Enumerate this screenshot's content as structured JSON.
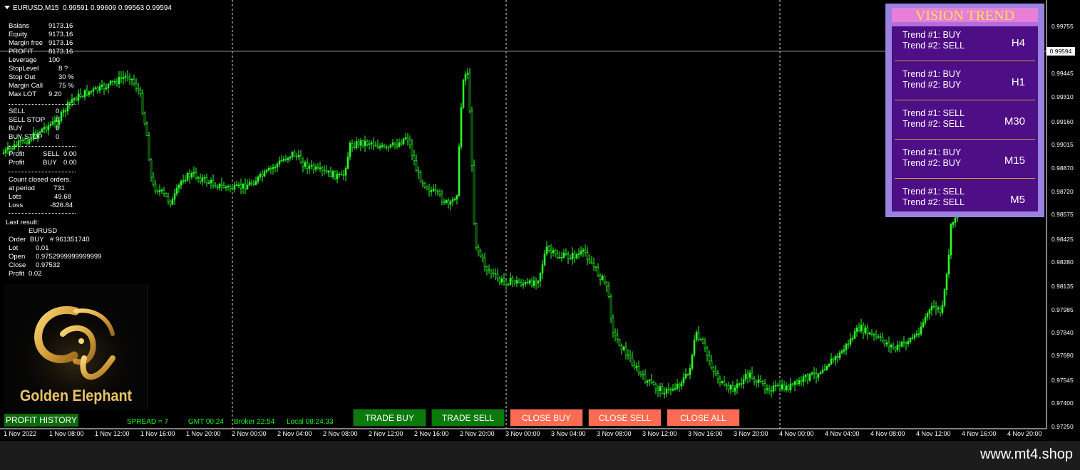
{
  "header": {
    "symbol": "EURUSD,M15",
    "ohlc": "0.99591 0.99609 0.99563 0.99594"
  },
  "account": [
    {
      "label": "Balans",
      "value": "9173.16"
    },
    {
      "label": "Equity",
      "value": "9173.16"
    },
    {
      "label": "Margin free",
      "value": "9173.16"
    },
    {
      "label": "PROFIT",
      "value": "8173.16"
    },
    {
      "label": "Leverage",
      "value": "100"
    },
    {
      "label": "StopLevel",
      "value": "8 ?"
    },
    {
      "label": "Stop Out",
      "value": "30 %"
    },
    {
      "label": "Margin Call",
      "value": "75 %"
    },
    {
      "label": "Max LOT",
      "value": "9.20"
    }
  ],
  "orders": [
    {
      "label": "SELL",
      "value": "0"
    },
    {
      "label": "SELL STOP",
      "value": "0"
    },
    {
      "label": "BUY",
      "value": "0"
    },
    {
      "label": "BUY STOP",
      "value": "0"
    }
  ],
  "profits": [
    {
      "label": "Profit",
      "side": "SELL",
      "value": "0.00"
    },
    {
      "label": "Profit",
      "side": "BUY",
      "value": "0.00"
    }
  ],
  "closed": {
    "title": "Count closed orders.",
    "rows": [
      {
        "label": "at period",
        "value": "731"
      },
      {
        "label": "Lots",
        "value": "49.68"
      },
      {
        "label": "Loss",
        "value": "-826.84"
      }
    ]
  },
  "last_result": {
    "title": "Last result:",
    "symbol": "EURUSD",
    "order_label": "Order",
    "order_side": "BUY",
    "order_no": "# 961351740",
    "lot_label": "Lot",
    "lot": "0.01",
    "open_label": "Open",
    "open": "0.9752999999999999",
    "close_label": "Close",
    "close": "0.97532",
    "profit_label": "Profit",
    "profit": "0.02"
  },
  "logo": {
    "text": "Golden Elephant",
    "icon": "golden-elephant-logo-icon"
  },
  "status_bar": {
    "profit_history": "PROFIT HISTORY",
    "spread": "SPREAD = 7",
    "gmt": "GMT 00:24",
    "broker": "Broker 22:54",
    "local": "Local 08:24:33"
  },
  "buttons": {
    "trade_buy": "TRADE BUY",
    "trade_sell": "TRADE SELL",
    "close_buy": "CLOSE BUY",
    "close_sell": "CLOSE SELL",
    "close_all": "CLOSE ALL"
  },
  "vision_trend": {
    "title": "VISION TREND",
    "rows": [
      {
        "t1": "Trend #1: BUY",
        "t2": "Trend #2: SELL",
        "tf": "H4"
      },
      {
        "t1": "Trend #1: BUY",
        "t2": "Trend #2: BUY",
        "tf": "H1"
      },
      {
        "t1": "Trend #1: SELL",
        "t2": "Trend #2: SELL",
        "tf": "M30"
      },
      {
        "t1": "Trend #1: BUY",
        "t2": "Trend #2: BUY",
        "tf": "M15"
      },
      {
        "t1": "Trend #1: SELL",
        "t2": "Trend #2: SELL",
        "tf": "M5"
      }
    ]
  },
  "price_axis": [
    "0.99755",
    "0.99445",
    "0.99310",
    "0.99160",
    "0.99015",
    "0.98870",
    "0.98720",
    "0.98575",
    "0.98425",
    "0.98280",
    "0.98135",
    "0.97985",
    "0.97840",
    "0.97690",
    "0.97545",
    "0.97400",
    "0.97250"
  ],
  "current_price": "0.99594",
  "time_axis": [
    "1 Nov 2022",
    "1 Nov 08:00",
    "1 Nov 12:00",
    "1 Nov 16:00",
    "1 Nov 20:00",
    "2 Nov 00:00",
    "2 Nov 04:00",
    "2 Nov 08:00",
    "2 Nov 12:00",
    "2 Nov 16:00",
    "2 Nov 20:00",
    "3 Nov 00:00",
    "3 Nov 04:00",
    "3 Nov 08:00",
    "3 Nov 12:00",
    "3 Nov 16:00",
    "3 Nov 20:00",
    "4 Nov 00:00",
    "4 Nov 04:00",
    "4 Nov 08:00",
    "4 Nov 12:00",
    "4 Nov 16:00",
    "4 Nov 20:00"
  ],
  "footer": "www.mt4.shop",
  "colors": {
    "candle": "#2bff2b",
    "trade_button": "#0a7a0a",
    "close_button": "#fa6b52",
    "panel": "#4e0e86",
    "panel_border": "#9a82e0",
    "title_bg": "#e77fd9",
    "title_text": "#f3e350"
  }
}
